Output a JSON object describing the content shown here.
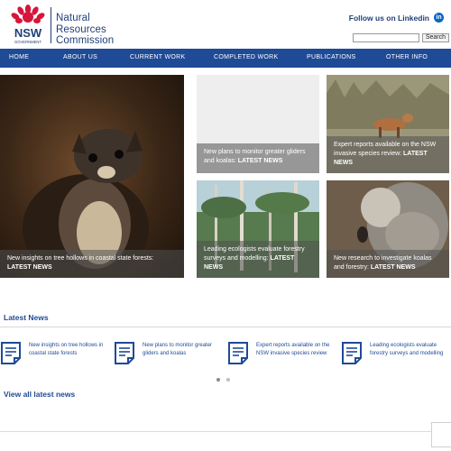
{
  "header": {
    "logo_text": "NSW",
    "logo_subtext": "GOVERNMENT",
    "brand_line1": "Natural",
    "brand_line2": "Resources",
    "brand_line3": "Commission",
    "linkedin_label": "Follow us on Linkedin",
    "linkedin_icon": "in",
    "search_placeholder": "",
    "search_button": "Search"
  },
  "nav": {
    "items": [
      "HOME",
      "ABOUT US",
      "CURRENT WORK",
      "COMPLETED WORK",
      "PUBLICATIONS",
      "OTHER INFO"
    ]
  },
  "tiles": [
    {
      "text": "New insights on tree hollows in coastal state forests: ",
      "tag": "LATEST NEWS"
    },
    {
      "text": "New plans to monitor greater gliders and koalas: ",
      "tag": "LATEST NEWS"
    },
    {
      "text": "Expert reports available on the NSW invasive species review: ",
      "tag": "LATEST NEWS"
    },
    {
      "text": "Leading ecologists evaluate forestry surveys and modelling: ",
      "tag": "LATEST NEWS"
    },
    {
      "text": "New research to investigate koalas and forestry: ",
      "tag": "LATEST NEWS"
    }
  ],
  "latest_news": {
    "title": "Latest News",
    "items": [
      {
        "text": "New insights on tree hollows in coastal state forests"
      },
      {
        "text": "New plans to monitor greater gliders and koalas"
      },
      {
        "text": "Expert reports available on the NSW invasive species review"
      },
      {
        "text": "Leading ecologists evaluate forestry surveys and modelling"
      }
    ],
    "view_all": "View all latest news"
  },
  "colors": {
    "brand": "#1f3f77",
    "nav_bg": "#1f4a96",
    "logo_red": "#d7153a"
  }
}
